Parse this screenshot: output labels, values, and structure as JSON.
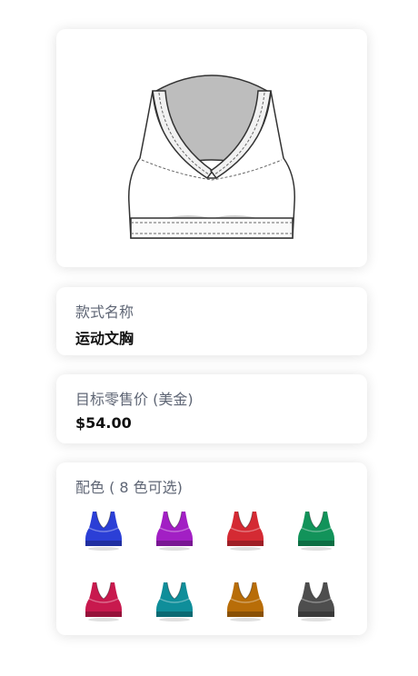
{
  "product": {
    "image_icon": "sports-bra-flat-sketch"
  },
  "style": {
    "label": "款式名称",
    "value": "运动文胸"
  },
  "price": {
    "label": "目标零售价 (美金)",
    "value": "$54.00"
  },
  "colors": {
    "label": "配色 ( 8 色可选)",
    "swatches": [
      {
        "icon": "sports-bra-icon",
        "color": "#2b3fd6"
      },
      {
        "icon": "sports-bra-icon",
        "color": "#a21fc4"
      },
      {
        "icon": "sports-bra-icon",
        "color": "#d42a33"
      },
      {
        "icon": "sports-bra-icon",
        "color": "#12935a"
      },
      {
        "icon": "sports-bra-icon",
        "color": "#c8194e"
      },
      {
        "icon": "sports-bra-icon",
        "color": "#0f8e9a"
      },
      {
        "icon": "sports-bra-icon",
        "color": "#b86d08"
      },
      {
        "icon": "sports-bra-icon",
        "color": "#4e4e4e"
      }
    ]
  }
}
